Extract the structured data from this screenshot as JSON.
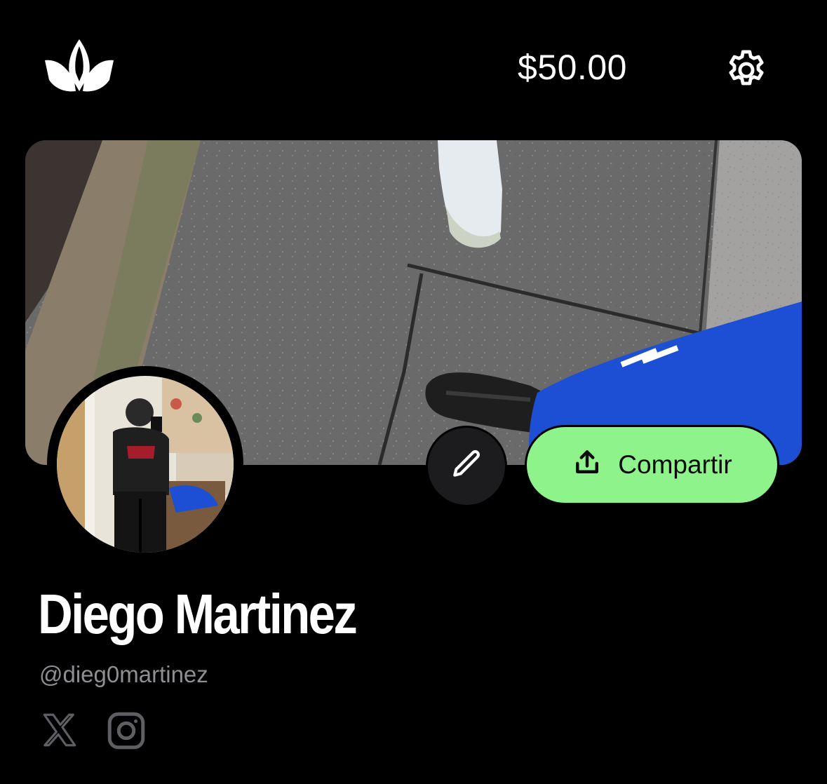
{
  "header": {
    "logo_icon": "crown-logo-icon",
    "balance": "$50.00",
    "settings_icon": "gear-icon"
  },
  "profile": {
    "cover_image": "sidewalk-photo-with-sneakers",
    "avatar_image": "mirror-selfie-photo",
    "name": "Diego Martinez",
    "handle": "@dieg0martinez"
  },
  "actions": {
    "edit_icon": "pencil-icon",
    "share_icon": "share-upload-icon",
    "share_label": "Compartir"
  },
  "social_links": [
    {
      "icon": "x-icon"
    },
    {
      "icon": "instagram-icon"
    }
  ],
  "colors": {
    "background": "#000000",
    "accent_button": "#8ef38b",
    "muted_text": "#8e8e93"
  }
}
